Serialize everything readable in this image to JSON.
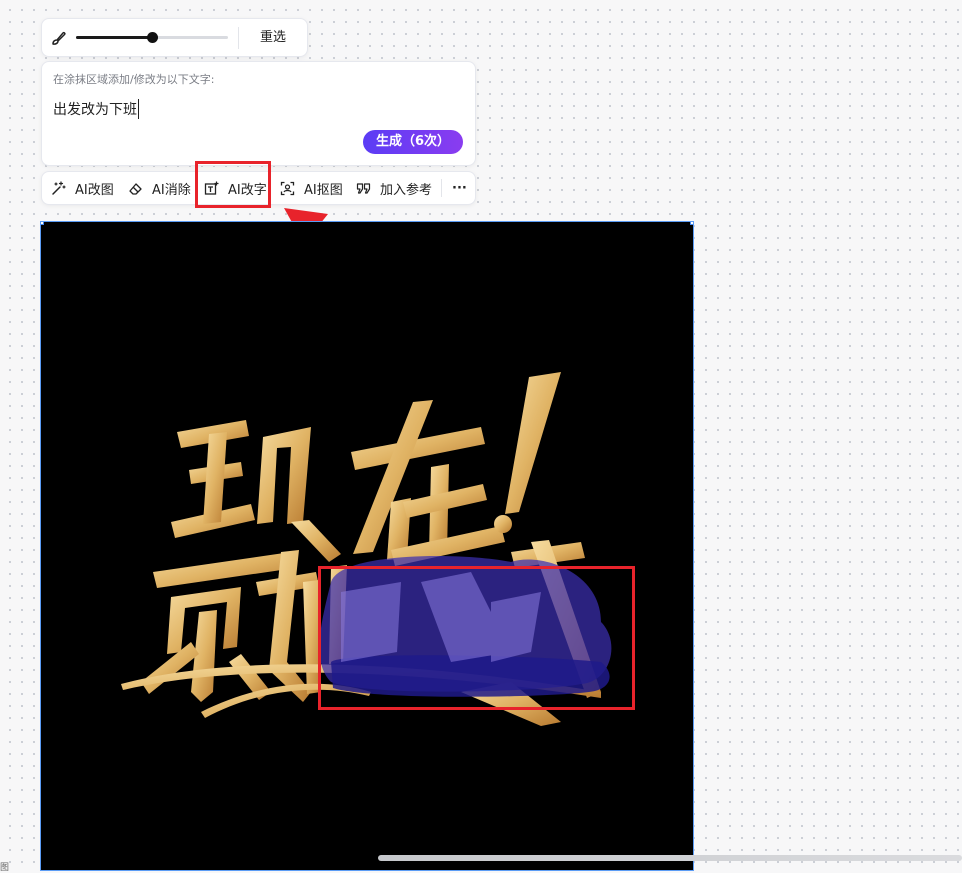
{
  "brush_bar": {
    "slider_value": 0.5,
    "reselect_label": "重选"
  },
  "text_panel": {
    "label": "在涂抹区域添加/修改为以下文字:",
    "input_value": "出发改为下班",
    "generate_label": "生成（6次）"
  },
  "toolbar": {
    "items": [
      {
        "label": "AI改图",
        "icon": "magic-wand-icon"
      },
      {
        "label": "AI消除",
        "icon": "eraser-icon"
      },
      {
        "label": "AI改字",
        "icon": "text-edit-icon"
      },
      {
        "label": "AI抠图",
        "icon": "cutout-icon"
      },
      {
        "label": "加入参考",
        "icon": "quote-icon"
      }
    ],
    "more_label": "···"
  },
  "canvas": {
    "artwork_text": [
      "现在!",
      "就出发"
    ]
  },
  "status_text": "图",
  "colors": {
    "accent_start": "#5b3cf5",
    "accent_end": "#8a3cf0",
    "annotation_red": "#e8232b",
    "selection_blue": "#4a8cf0"
  }
}
